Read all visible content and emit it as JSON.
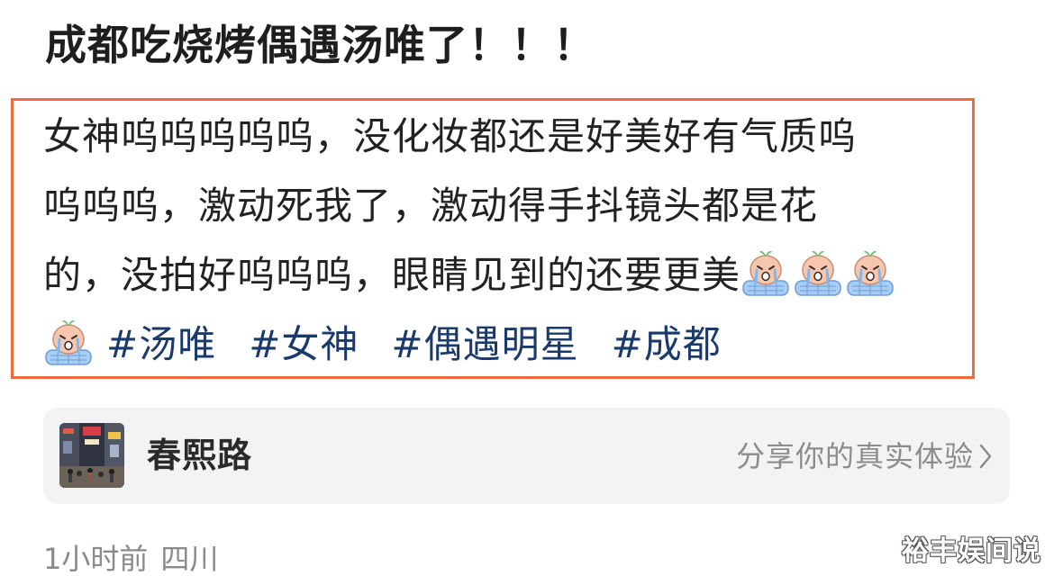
{
  "post": {
    "title": "成都吃烧烤偶遇汤唯了！！！",
    "body_lines": [
      "女神呜呜呜呜呜，没化妆都还是好美好有气质呜",
      "呜呜呜，激动死我了，激动得手抖镜头都是花",
      "的，没拍好呜呜呜，眼睛见到的还要更美"
    ],
    "emoji_name": "crying-face-emoji",
    "hashtags": [
      "#汤唯",
      "#女神",
      "#偶遇明星",
      "#成都"
    ]
  },
  "location_card": {
    "name": "春熙路",
    "share_label": "分享你的真实体验",
    "thumbnail_icon": "street-photo-thumbnail"
  },
  "meta": {
    "time": "1小时前",
    "region": "四川"
  },
  "watermark": "裕丰娱间说",
  "colors": {
    "highlight_border": "#ef6b3f",
    "hashtag": "#1a3a6b",
    "card_background": "#f3f3f3",
    "meta_text": "#8a8a8a"
  }
}
